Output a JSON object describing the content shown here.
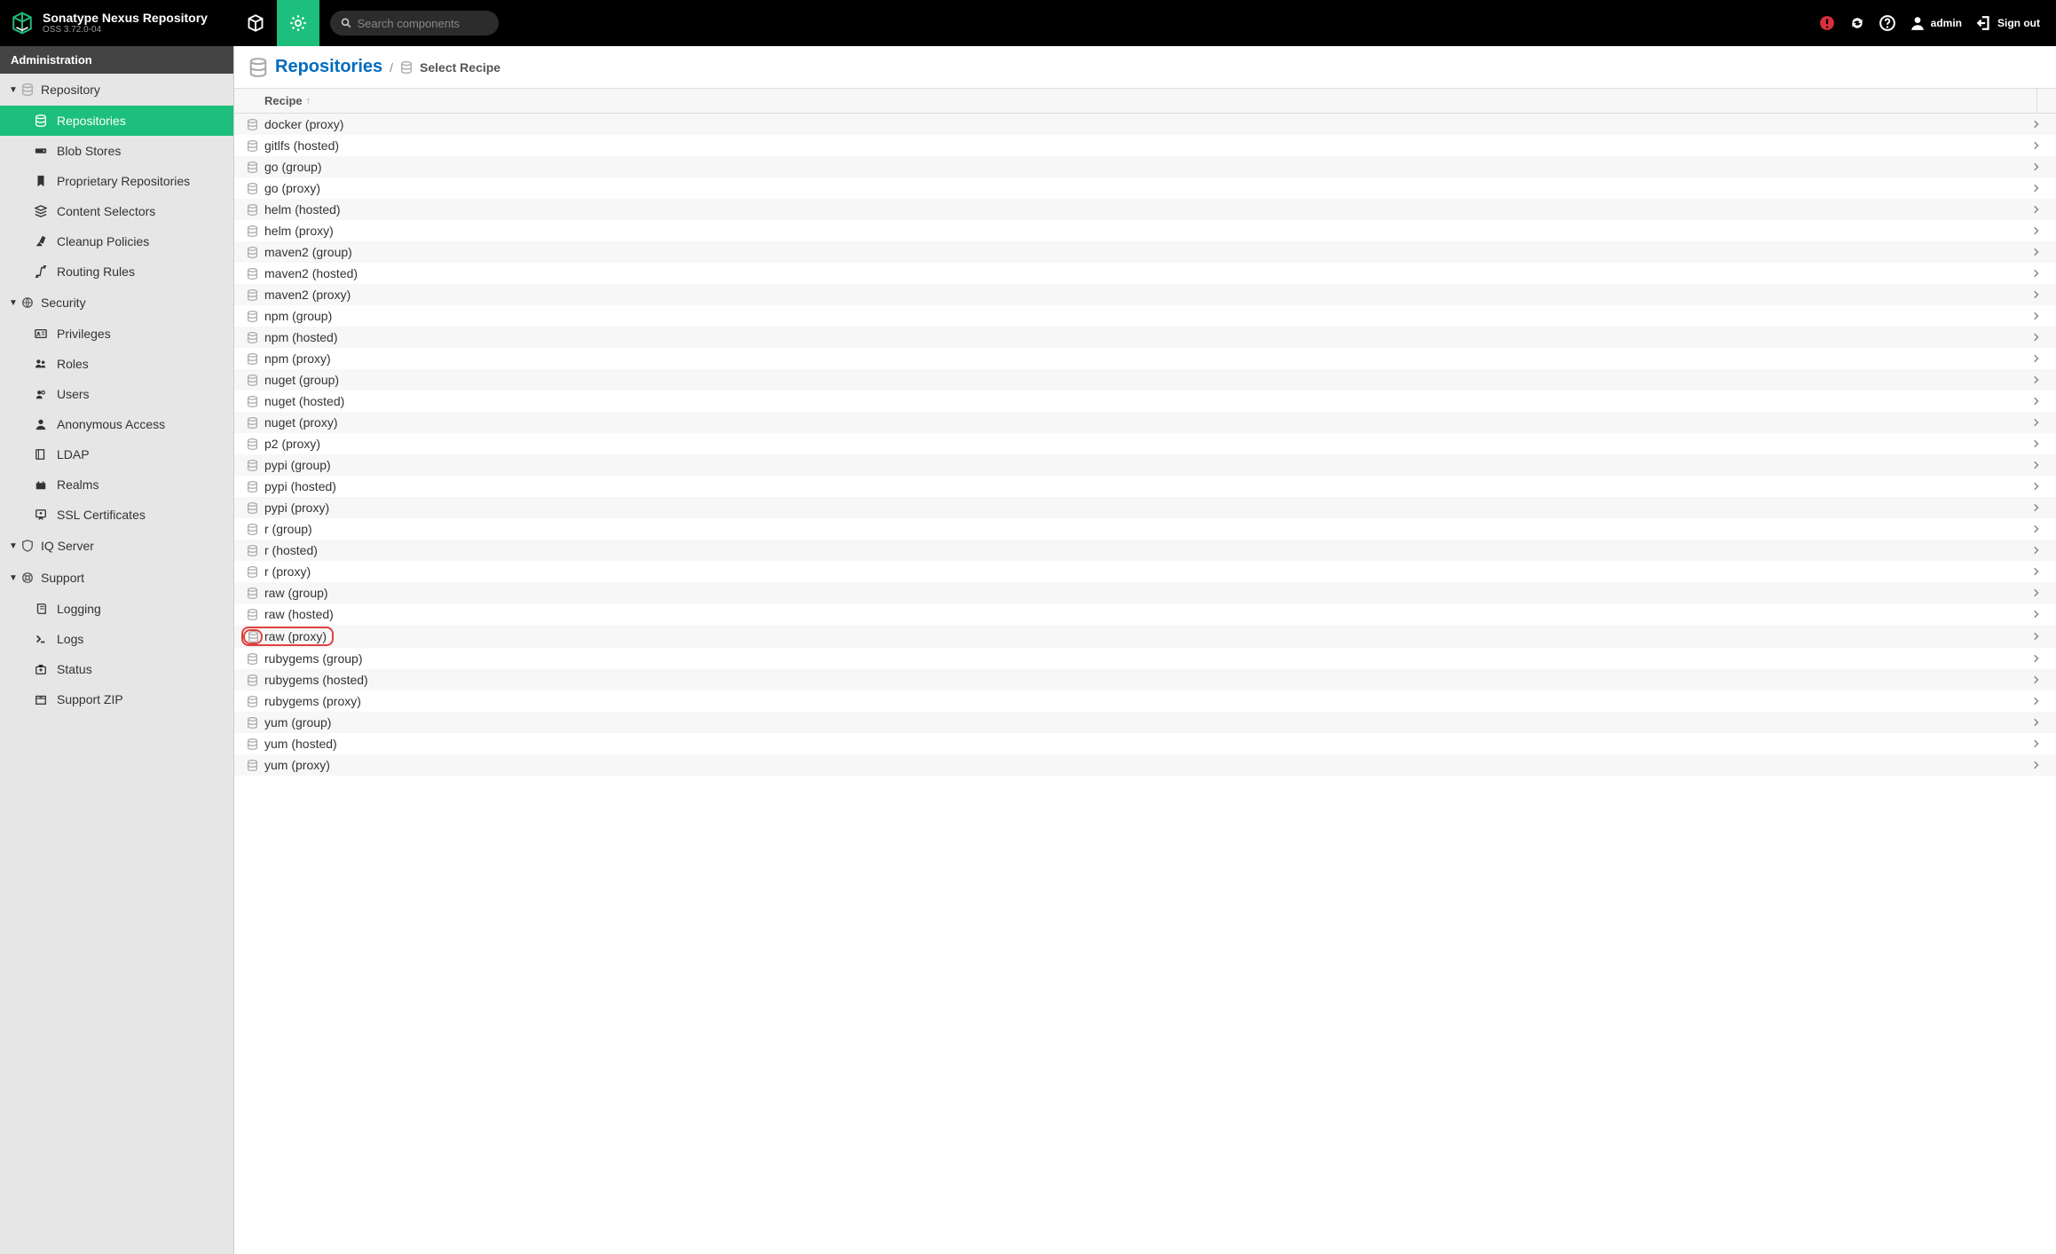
{
  "brand": {
    "title": "Sonatype Nexus Repository",
    "version": "OSS 3.72.0-04"
  },
  "search": {
    "placeholder": "Search components"
  },
  "header_right": {
    "user_label": "admin",
    "signout_label": "Sign out"
  },
  "sidebar_title": "Administration",
  "sidebar": {
    "groups": [
      {
        "label": "Repository",
        "items": [
          {
            "label": "Repositories",
            "icon": "db",
            "active": true
          },
          {
            "label": "Blob Stores",
            "icon": "hdd"
          },
          {
            "label": "Proprietary Repositories",
            "icon": "bookmark"
          },
          {
            "label": "Content Selectors",
            "icon": "layers"
          },
          {
            "label": "Cleanup Policies",
            "icon": "broom"
          },
          {
            "label": "Routing Rules",
            "icon": "route"
          }
        ]
      },
      {
        "label": "Security",
        "icon": "globe",
        "items": [
          {
            "label": "Privileges",
            "icon": "idcard"
          },
          {
            "label": "Roles",
            "icon": "usergroup"
          },
          {
            "label": "Users",
            "icon": "users"
          },
          {
            "label": "Anonymous Access",
            "icon": "user"
          },
          {
            "label": "LDAP",
            "icon": "book"
          },
          {
            "label": "Realms",
            "icon": "castle"
          },
          {
            "label": "SSL Certificates",
            "icon": "cert"
          }
        ]
      },
      {
        "label": "IQ Server",
        "icon": "shield",
        "items": []
      },
      {
        "label": "Support",
        "icon": "lifebuoy",
        "items": [
          {
            "label": "Logging",
            "icon": "scroll"
          },
          {
            "label": "Logs",
            "icon": "terminal"
          },
          {
            "label": "Status",
            "icon": "medkit"
          },
          {
            "label": "Support ZIP",
            "icon": "archive"
          }
        ]
      }
    ]
  },
  "main": {
    "title_link": "Repositories",
    "subtitle": "Select Recipe",
    "column_header": "Recipe",
    "recipes": [
      "docker (proxy)",
      "gitlfs (hosted)",
      "go (group)",
      "go (proxy)",
      "helm (hosted)",
      "helm (proxy)",
      "maven2 (group)",
      "maven2 (hosted)",
      "maven2 (proxy)",
      "npm (group)",
      "npm (hosted)",
      "npm (proxy)",
      "nuget (group)",
      "nuget (hosted)",
      "nuget (proxy)",
      "p2 (proxy)",
      "pypi (group)",
      "pypi (hosted)",
      "pypi (proxy)",
      "r (group)",
      "r (hosted)",
      "r (proxy)",
      "raw (group)",
      "raw (hosted)",
      "raw (proxy)",
      "rubygems (group)",
      "rubygems (hosted)",
      "rubygems (proxy)",
      "yum (group)",
      "yum (hosted)",
      "yum (proxy)"
    ],
    "highlight": "raw (proxy)"
  }
}
